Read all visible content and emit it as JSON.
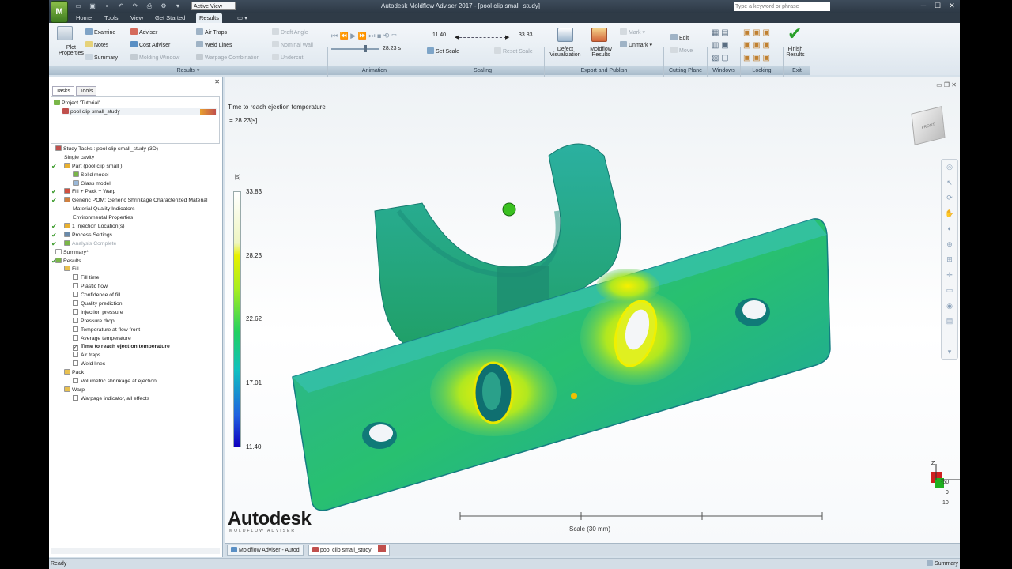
{
  "app": {
    "window_title": "Autodesk Moldflow Adviser 2017 - [pool clip small_study]",
    "active_view": "Active View",
    "search_placeholder": "Type a keyword or phrase",
    "logo": "M",
    "window_buttons": [
      "─",
      "☐",
      "✕"
    ]
  },
  "tabs": [
    "Home",
    "Tools",
    "View",
    "Get Started",
    "Results"
  ],
  "active_tab": "Results",
  "ribbon": {
    "results": {
      "plot_properties": [
        "Plot",
        "Properties"
      ],
      "examine": "Examine",
      "notes": "Notes",
      "summary": "Summary",
      "adviser": "Adviser",
      "cost_adviser": "Cost Adviser",
      "molding_window": "Molding Window",
      "air_traps": "Air Traps",
      "weld_lines": "Weld Lines",
      "warpage_combination": "Warpage Combination",
      "draft_angle": "Draft Angle",
      "nominal_wall": "Nominal Wall",
      "undercut": "Undercut"
    },
    "animation": {
      "time": "28.23 s"
    },
    "scaling": {
      "min": "11.40",
      "max": "33.83",
      "set_scale": "Set Scale",
      "reset_scale": "Reset Scale"
    },
    "export": {
      "defect": [
        "Defect",
        "Visualization"
      ],
      "moldflow": [
        "Moldflow",
        "Results"
      ],
      "mark": "Mark",
      "unmark": "Unmark"
    },
    "cutting": {
      "edit": "Edit",
      "move": "Move"
    },
    "exit": {
      "finish": [
        "Finish",
        "Results"
      ]
    },
    "panels": [
      "Results ▾",
      "Animation",
      "Scaling",
      "Export and Publish",
      "Cutting Plane",
      "Windows",
      "Locking",
      "Exit"
    ]
  },
  "left_pane": {
    "tabs": [
      "Tasks",
      "Tools"
    ],
    "project": "Project 'Tutorial'",
    "study": "pool clip small_study",
    "tree": [
      {
        "label": "Study Tasks : pool clip small_study (3D)",
        "indent": 0,
        "check": false,
        "icon": "#c0504d",
        "bold": false
      },
      {
        "label": "Single cavity",
        "indent": 1,
        "check": false,
        "icon": "",
        "bold": false
      },
      {
        "label": "Part (pool clip small )",
        "indent": 1,
        "check": true,
        "icon": "#e8b030",
        "bold": false
      },
      {
        "label": "Solid model",
        "indent": 2,
        "check": false,
        "icon": "#7ab648",
        "bold": false
      },
      {
        "label": "Glass model",
        "indent": 2,
        "check": false,
        "icon": "#9ab8d8",
        "bold": false
      },
      {
        "label": "Fill + Pack + Warp",
        "indent": 1,
        "check": true,
        "icon": "#d05040",
        "bold": false
      },
      {
        "label": "Generic POM: Generic Shrinkage Characterized Material",
        "indent": 1,
        "check": true,
        "icon": "#d08040",
        "bold": false
      },
      {
        "label": "Material Quality Indicators",
        "indent": 2,
        "check": false,
        "icon": "",
        "bold": false
      },
      {
        "label": "Environmental Properties",
        "indent": 2,
        "check": false,
        "icon": "",
        "bold": false
      },
      {
        "label": "1 Injection Location(s)",
        "indent": 1,
        "check": true,
        "icon": "#e8b030",
        "bold": false
      },
      {
        "label": "Process Settings",
        "indent": 1,
        "check": true,
        "icon": "#6a8aaa",
        "bold": false
      },
      {
        "label": "Analysis Complete",
        "indent": 1,
        "check": true,
        "icon": "#7ab648",
        "bold": false,
        "dim": true
      },
      {
        "label": "Summary*",
        "indent": 0,
        "check": false,
        "icon": "#ffffff",
        "bold": false
      },
      {
        "label": "Results",
        "indent": 0,
        "check": true,
        "icon": "#7ab648",
        "bold": false
      },
      {
        "label": "Fill",
        "indent": 1,
        "check": false,
        "icon": "#e8c050",
        "bold": false
      },
      {
        "label": "Fill time",
        "indent": 2,
        "check": false,
        "box": true,
        "bold": false
      },
      {
        "label": "Plastic flow",
        "indent": 2,
        "check": false,
        "box": true,
        "bold": false
      },
      {
        "label": "Confidence of fill",
        "indent": 2,
        "check": false,
        "box": true,
        "bold": false
      },
      {
        "label": "Quality prediction",
        "indent": 2,
        "check": false,
        "box": true,
        "bold": false
      },
      {
        "label": "Injection pressure",
        "indent": 2,
        "check": false,
        "box": true,
        "bold": false
      },
      {
        "label": "Pressure drop",
        "indent": 2,
        "check": false,
        "box": true,
        "bold": false
      },
      {
        "label": "Temperature at flow front",
        "indent": 2,
        "check": false,
        "box": true,
        "bold": false
      },
      {
        "label": "Average temperature",
        "indent": 2,
        "check": false,
        "box": true,
        "bold": false
      },
      {
        "label": "Time to reach ejection temperature",
        "indent": 2,
        "check": false,
        "box": true,
        "checked": true,
        "bold": true
      },
      {
        "label": "Air traps",
        "indent": 2,
        "check": false,
        "box": true,
        "bold": false
      },
      {
        "label": "Weld lines",
        "indent": 2,
        "check": false,
        "box": true,
        "bold": false
      },
      {
        "label": "Pack",
        "indent": 1,
        "check": false,
        "icon": "#e8c050",
        "bold": false
      },
      {
        "label": "Volumetric shrinkage at ejection",
        "indent": 2,
        "check": false,
        "box": true,
        "bold": false
      },
      {
        "label": "Warp",
        "indent": 1,
        "check": false,
        "icon": "#e8c050",
        "bold": false
      },
      {
        "label": "Warpage indicator, all effects",
        "indent": 2,
        "check": false,
        "box": true,
        "bold": false
      }
    ]
  },
  "viewport": {
    "result_title": "Time to reach ejection temperature",
    "result_value": "= 28.23[s]",
    "unit": "[s]",
    "legend_ticks": [
      "33.83",
      "28.23",
      "22.62",
      "17.01",
      "11.40"
    ],
    "scale_label": "Scale (30 mm)",
    "logo": "Autodesk",
    "logo_sub": "MOLDFLOW ADVISER",
    "axis_x": "X",
    "axis_z": "Z",
    "side_numbers": [
      "-50",
      "9",
      "10"
    ],
    "viewcube_text": "FRONT"
  },
  "doc_tabs": [
    "Moldflow Adviser - Autod",
    "pool clip small_study"
  ],
  "status": {
    "left": "Ready",
    "right": "Summary"
  }
}
